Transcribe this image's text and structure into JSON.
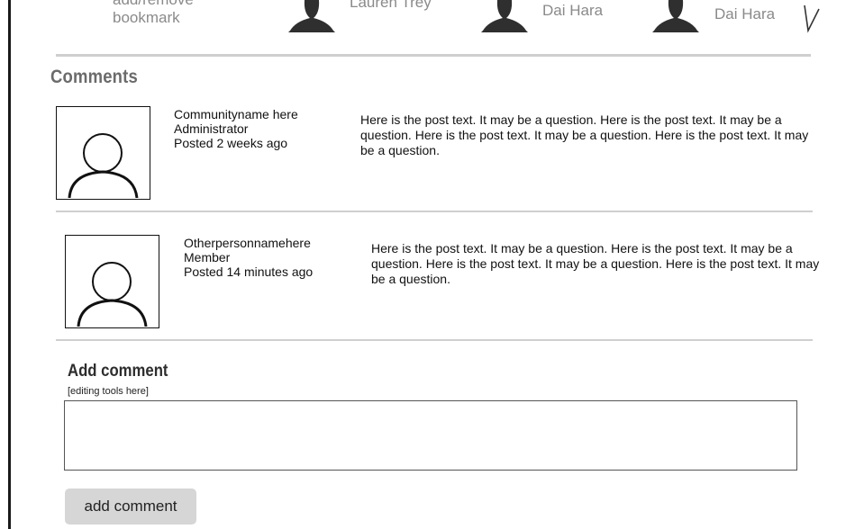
{
  "top_strip": {
    "bookmark_link_line1": "add/remove",
    "bookmark_link_line2": "bookmark",
    "followers": [
      {
        "name": "Lauren Trey"
      },
      {
        "name": "Dai Hara"
      },
      {
        "name": "Dai Hara"
      }
    ],
    "more_icon": "chevron-right-icon"
  },
  "comments_section": {
    "title": "Comments",
    "comments": [
      {
        "author": "Communityname here",
        "role": "Administrator",
        "posted": "Posted 2 weeks ago",
        "text": "Here is the post text. It may be a question. Here is the post text. It may be a question. Here is the post text. It may be a question. Here is the post text. It may be a question.",
        "avatar_icon": "user-avatar-icon"
      },
      {
        "author": "Otherpersonnamehere",
        "role": "Member",
        "posted": "Posted 14 minutes ago",
        "text": "Here is the post text. It may be a question. Here is the post text. It may be a question. Here is the post text. It may be a question. Here is the post text. It may be a question.",
        "avatar_icon": "user-avatar-icon"
      }
    ]
  },
  "add_comment": {
    "title": "Add comment",
    "editing_tools_placeholder": "[editing tools here]",
    "input_value": "",
    "button_label": "add comment"
  },
  "colors": {
    "border_dark": "#1a1a1a",
    "divider": "#cfcfcf",
    "muted_text": "#8a8a8a",
    "button_bg": "#d6d6d6"
  }
}
